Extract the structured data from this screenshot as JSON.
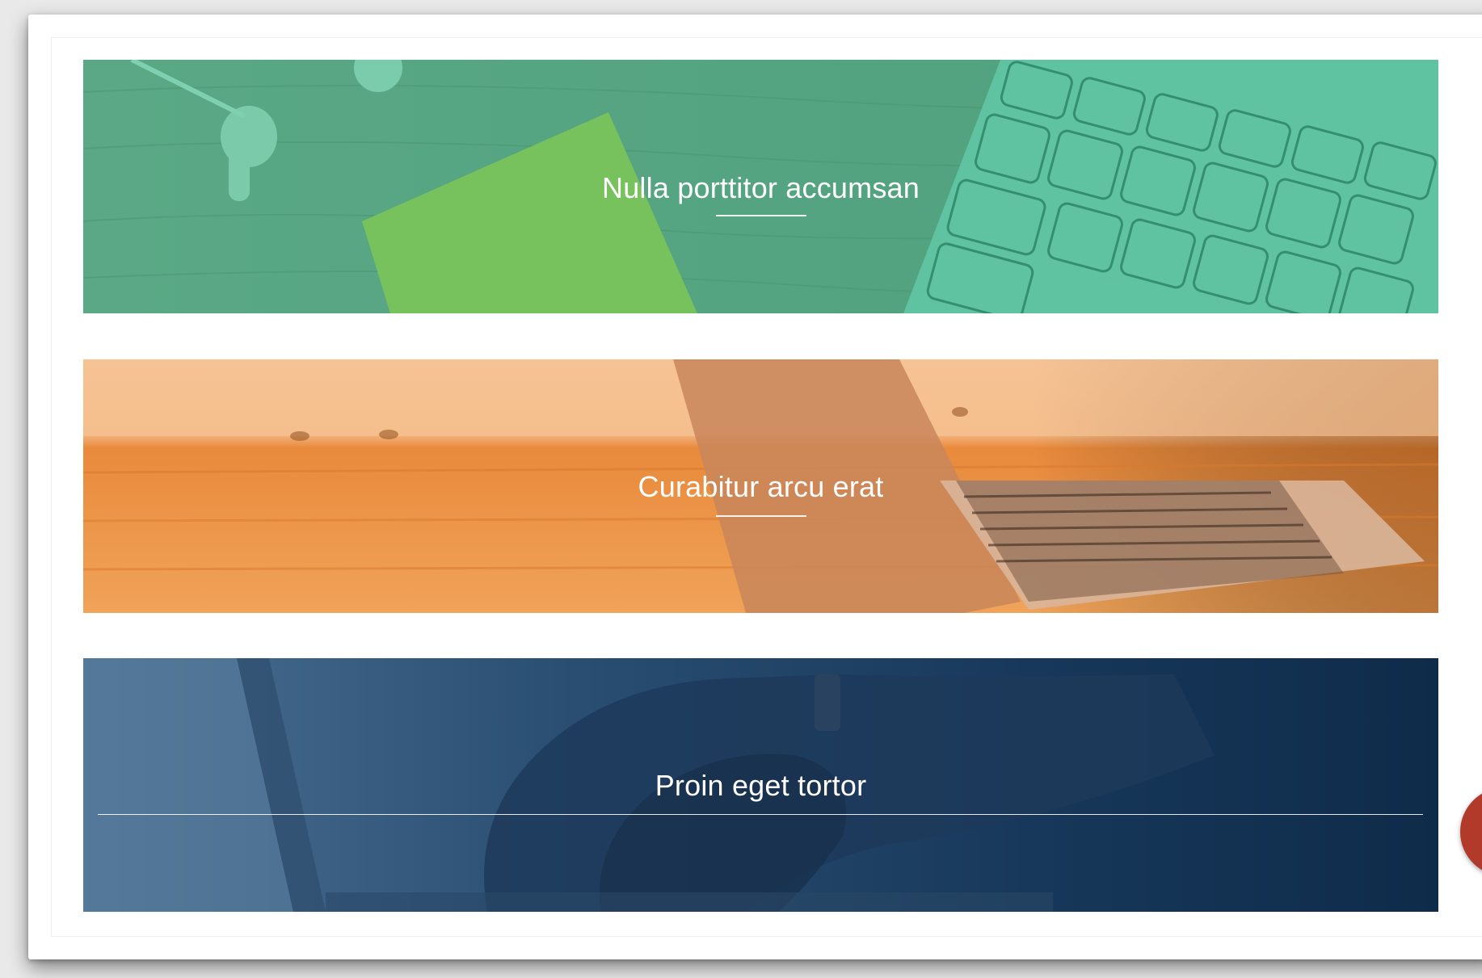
{
  "banners": [
    {
      "title": "Nulla porttitor accumsan",
      "tint": "#4fae86"
    },
    {
      "title": "Curabitur arcu erat",
      "tint": "#f0a05a"
    },
    {
      "title": "Proin eget tortor",
      "tint": "#1f3f63"
    }
  ],
  "fab": {
    "icon": "circle-button",
    "color": "#b23a2a"
  }
}
